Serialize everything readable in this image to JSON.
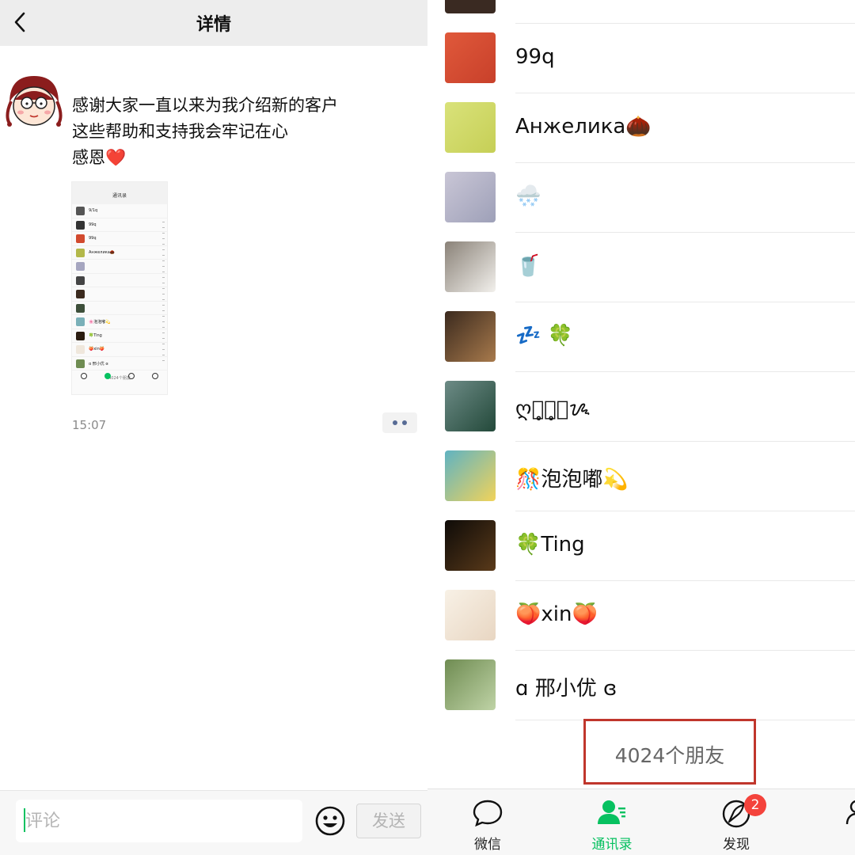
{
  "detail_page": {
    "title": "详情",
    "post": {
      "lines": [
        "感谢大家一直以来为我介绍新的客户",
        "这些帮助和支持我会牢记在心",
        "感恩"
      ],
      "heart": "❤️",
      "time": "15:07",
      "thumbnail": {
        "title": "通讯录",
        "rows": [
          "9/1q",
          "99q",
          "99q",
          "Анжелика🌰",
          "",
          "",
          "",
          "",
          "🌸泡泡嘟💫",
          "🍀Ting",
          "🍑xin🍑",
          "ɑ 邢小优 ɞ"
        ],
        "count": "4024个朋友"
      }
    },
    "comment": {
      "placeholder": "评论",
      "send_label": "发送"
    }
  },
  "contacts_page": {
    "contacts": [
      {
        "name": "99q"
      },
      {
        "name": "Анжелика🌰"
      },
      {
        "name": "🌨️"
      },
      {
        "name": "🥤"
      },
      {
        "name": "💤 🍀"
      },
      {
        "name": "ღ落̥͙̥͙ᝰ"
      },
      {
        "name": "🎊泡泡嘟💫"
      },
      {
        "name": "🍀Ting"
      },
      {
        "name": "🍑xin🍑"
      },
      {
        "name": "ɑ 邢小优 ɞ"
      }
    ],
    "friend_count": "4024个朋友",
    "tabs": [
      {
        "label": "微信",
        "icon": "chat-icon"
      },
      {
        "label": "通讯录",
        "icon": "contacts-icon",
        "active": true
      },
      {
        "label": "发现",
        "icon": "discover-icon",
        "badge": "2"
      }
    ]
  },
  "colors": {
    "accent": "#07c160",
    "highlight_box": "#c0362c",
    "badge": "#f4433c",
    "link": "#576b95"
  }
}
